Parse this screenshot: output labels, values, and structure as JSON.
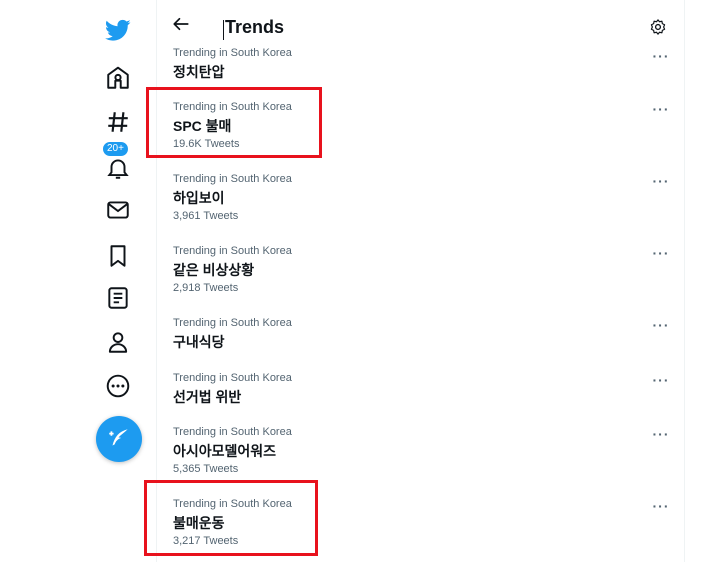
{
  "header": {
    "title": "Trends"
  },
  "nav": {
    "notifications_badge": "20+"
  },
  "trends": [
    {
      "meta": "Trending in South Korea",
      "name": "정치탄압",
      "count": ""
    },
    {
      "meta": "Trending in South Korea",
      "name": "SPC 불매",
      "count": "19.6K Tweets"
    },
    {
      "meta": "Trending in South Korea",
      "name": "하입보이",
      "count": "3,961 Tweets"
    },
    {
      "meta": "Trending in South Korea",
      "name": "같은 비상상황",
      "count": "2,918 Tweets"
    },
    {
      "meta": "Trending in South Korea",
      "name": "구내식당",
      "count": ""
    },
    {
      "meta": "Trending in South Korea",
      "name": "선거법 위반",
      "count": ""
    },
    {
      "meta": "Trending in South Korea",
      "name": "아시아모델어워즈",
      "count": "5,365 Tweets"
    },
    {
      "meta": "Trending in South Korea",
      "name": "불매운동",
      "count": "3,217 Tweets"
    }
  ],
  "colors": {
    "brand": "#1d9bf0",
    "highlight": "#e8121d",
    "text": "#0f1419",
    "muted": "#536471"
  },
  "icons": [
    "twitter-logo-icon",
    "home-icon",
    "explore-hash-icon",
    "bell-icon",
    "mail-icon",
    "bookmark-icon",
    "list-icon",
    "profile-icon",
    "more-circle-icon",
    "compose-feather-icon",
    "back-arrow-icon",
    "settings-gear-icon",
    "more-dots-icon"
  ]
}
